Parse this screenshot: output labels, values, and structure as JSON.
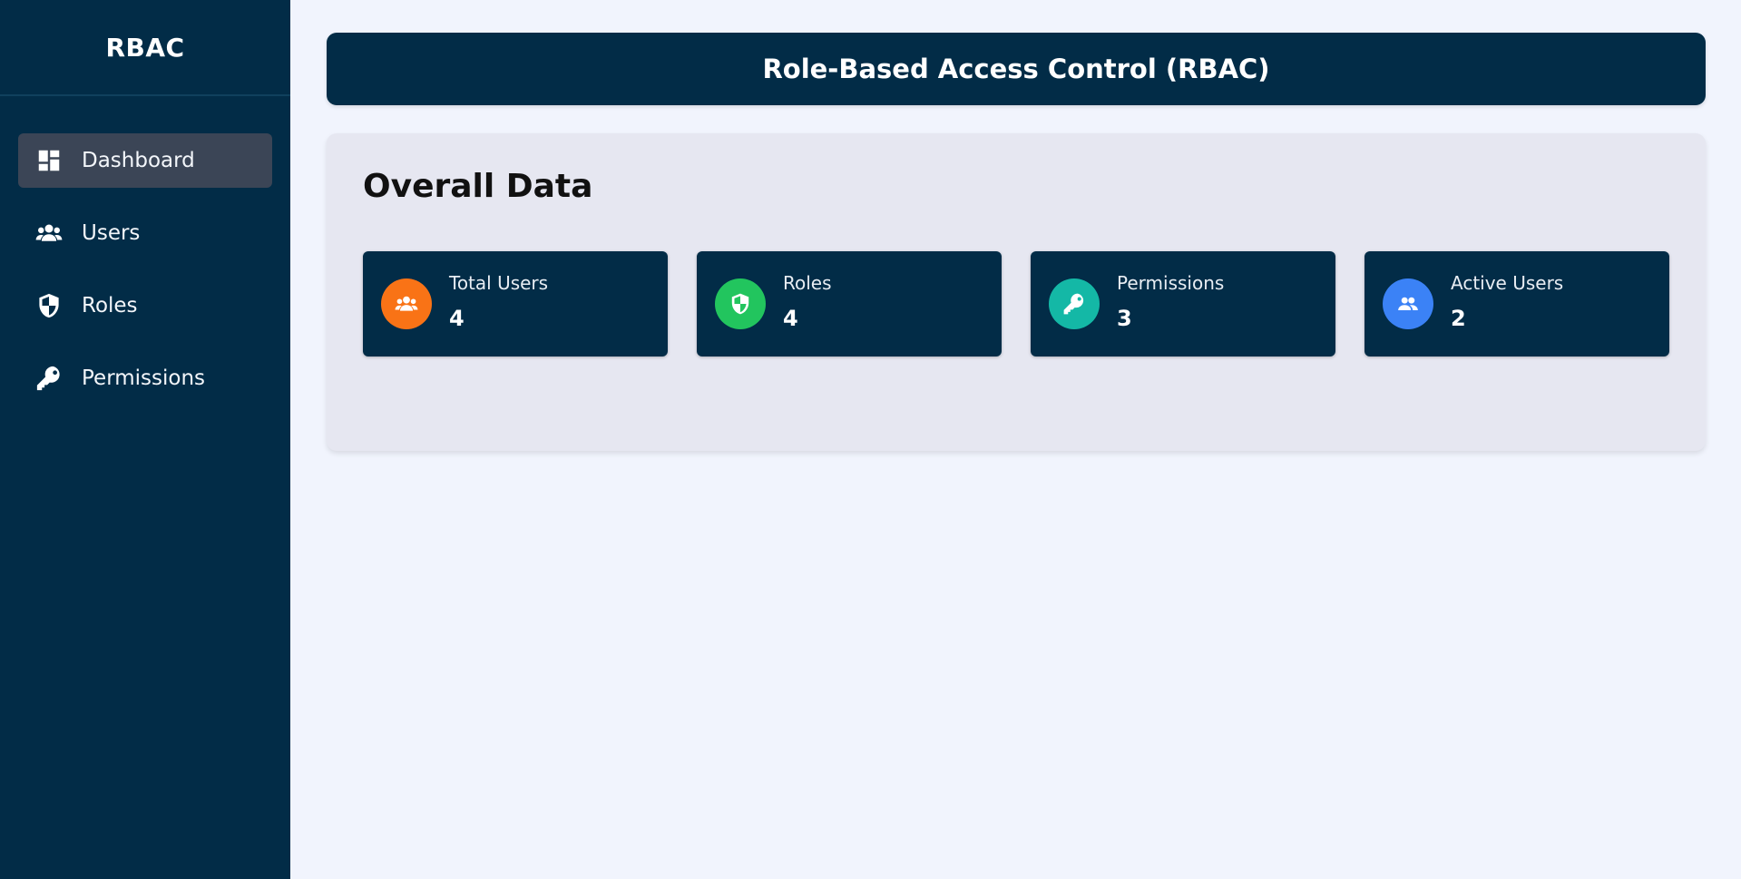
{
  "sidebar": {
    "brand": "RBAC",
    "items": [
      {
        "label": "Dashboard",
        "icon": "dashboard-icon",
        "active": true
      },
      {
        "label": "Users",
        "icon": "users-icon",
        "active": false
      },
      {
        "label": "Roles",
        "icon": "shield-icon",
        "active": false
      },
      {
        "label": "Permissions",
        "icon": "key-icon",
        "active": false
      }
    ]
  },
  "header": {
    "title": "Role-Based Access Control (RBAC)"
  },
  "overview": {
    "title": "Overall Data",
    "cards": [
      {
        "label": "Total Users",
        "value": "4",
        "icon": "users-icon",
        "color": "#f97316"
      },
      {
        "label": "Roles",
        "value": "4",
        "icon": "shield-icon",
        "color": "#22c55e"
      },
      {
        "label": "Permissions",
        "value": "3",
        "icon": "key-icon",
        "color": "#14b8a6"
      },
      {
        "label": "Active Users",
        "value": "2",
        "icon": "user-group-icon",
        "color": "#3b82f6"
      }
    ]
  },
  "colors": {
    "sidebar_bg": "#022c47",
    "page_bg": "#f1f4fd",
    "panel_bg": "#e6e7f1",
    "active_item_bg": "#3b4556"
  }
}
